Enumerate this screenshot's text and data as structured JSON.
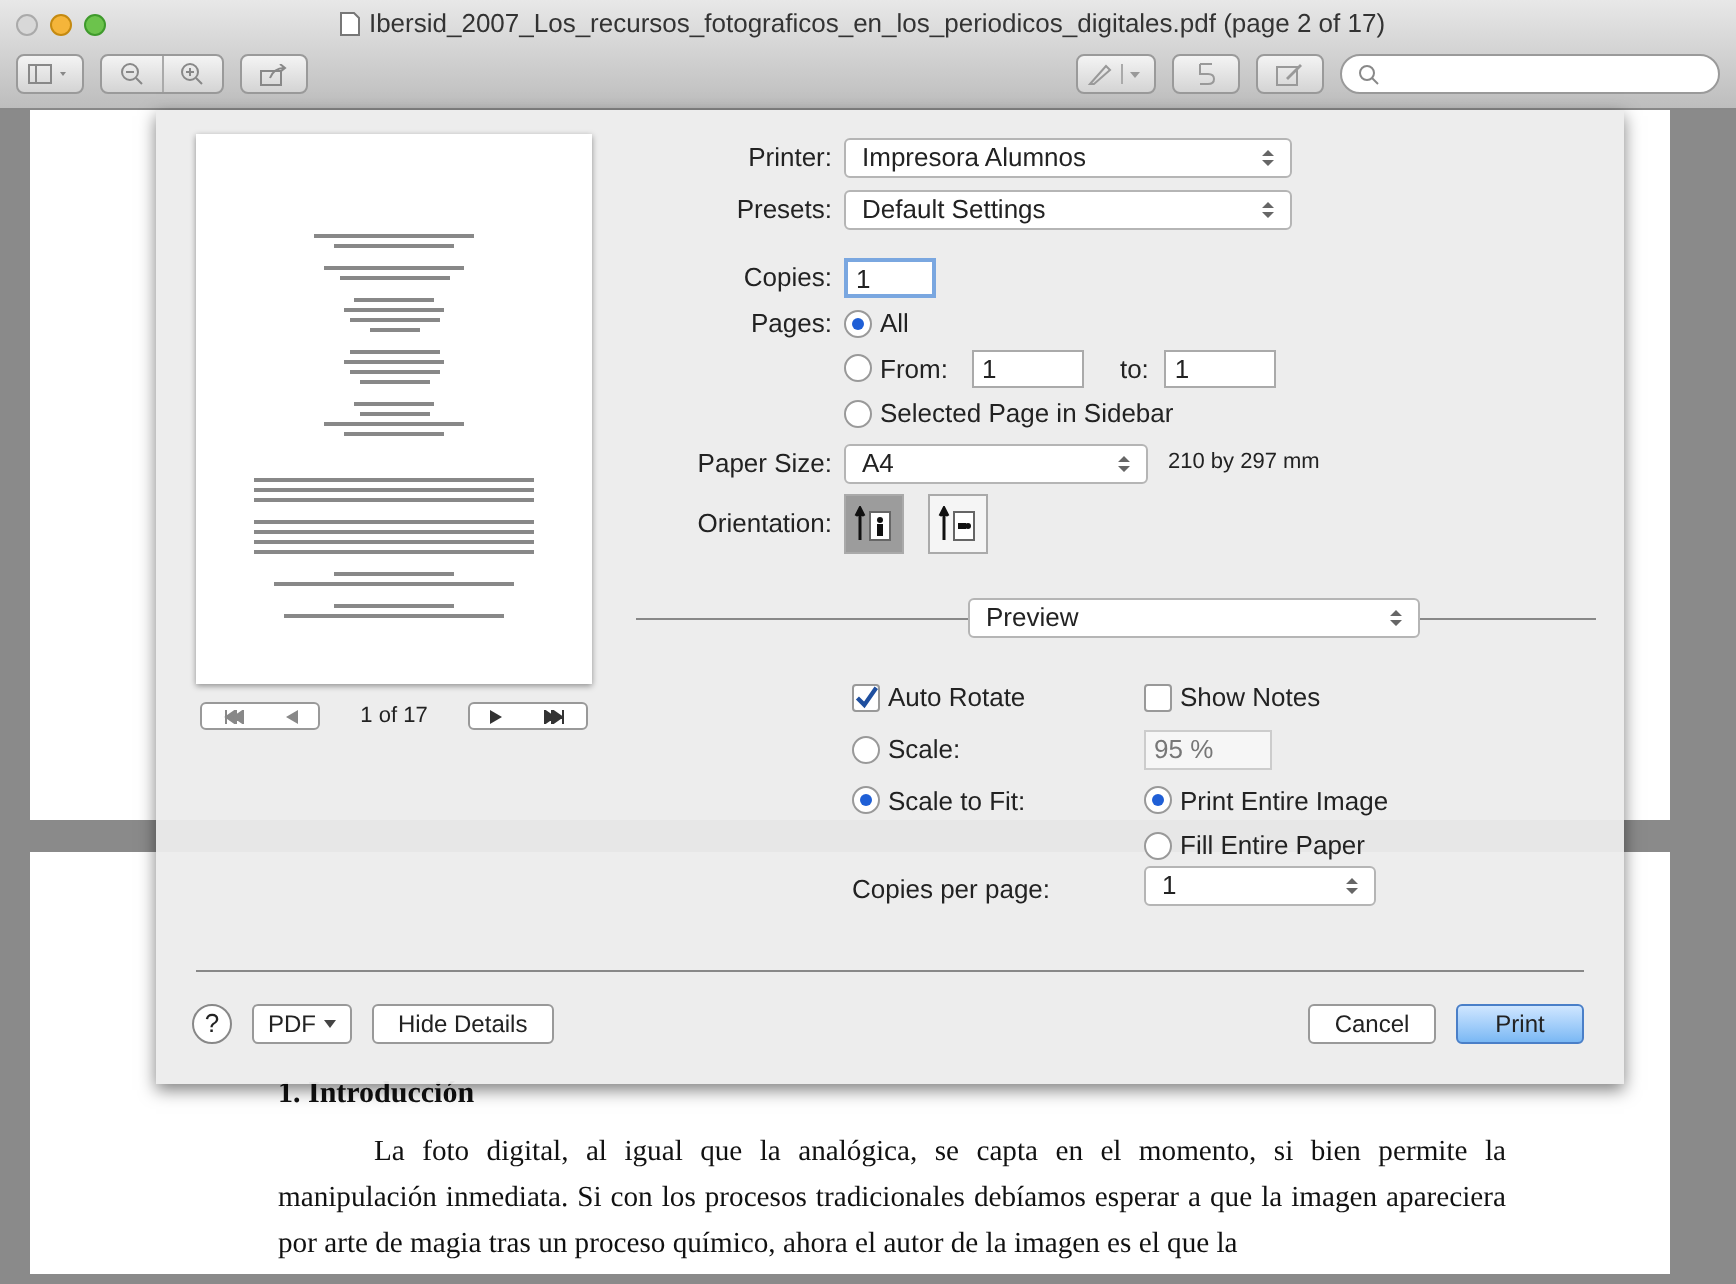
{
  "window": {
    "title": "Ibersid_2007_Los_recursos_fotograficos_en_los_periodicos_digitales.pdf (page 2 of 17)"
  },
  "print_sheet": {
    "preview": {
      "page_counter": "1 of 17"
    },
    "printer": {
      "label": "Printer:",
      "value": "Impresora Alumnos"
    },
    "presets": {
      "label": "Presets:",
      "value": "Default Settings"
    },
    "copies": {
      "label": "Copies:",
      "value": "1"
    },
    "pages": {
      "label": "Pages:",
      "options": [
        {
          "kind": "all",
          "label": "All",
          "selected": true
        },
        {
          "kind": "range",
          "label": "From:",
          "from": "1",
          "to_label": "to:",
          "to": "1",
          "selected": false
        },
        {
          "kind": "plain",
          "label": "Selected Page in Sidebar",
          "selected": false
        }
      ]
    },
    "paper_size": {
      "label": "Paper Size:",
      "value": "A4",
      "dimensions": "210 by 297 mm"
    },
    "orientation": {
      "label": "Orientation:",
      "options": [
        {
          "kind": "portrait",
          "selected": true
        },
        {
          "kind": "landscape",
          "selected": false
        }
      ]
    },
    "section": {
      "value": "Preview"
    },
    "auto_rotate": {
      "label": "Auto Rotate",
      "checked": true
    },
    "show_notes": {
      "label": "Show Notes",
      "checked": false
    },
    "scale": {
      "label": "Scale:",
      "value": "95 %",
      "selected": false
    },
    "scale_to_fit": {
      "label": "Scale to Fit:",
      "selected": true
    },
    "fit_options": [
      {
        "label": "Print Entire Image",
        "selected": true
      },
      {
        "label": "Fill Entire Paper",
        "selected": false
      }
    ],
    "copies_per_page": {
      "label": "Copies per page:",
      "value": "1"
    },
    "buttons": {
      "help": "?",
      "pdf": "PDF",
      "hide_details": "Hide Details",
      "cancel": "Cancel",
      "print": "Print"
    }
  },
  "document": {
    "heading": "1. Introducción",
    "paragraph": "La foto digital, al igual que la analógica, se capta en el momento, si bien permite la manipulación inmediata. Si con los procesos tradicionales debíamos esperar a que la imagen apareciera por arte de magia tras un proceso químico, ahora el autor de la imagen  es el que la"
  }
}
